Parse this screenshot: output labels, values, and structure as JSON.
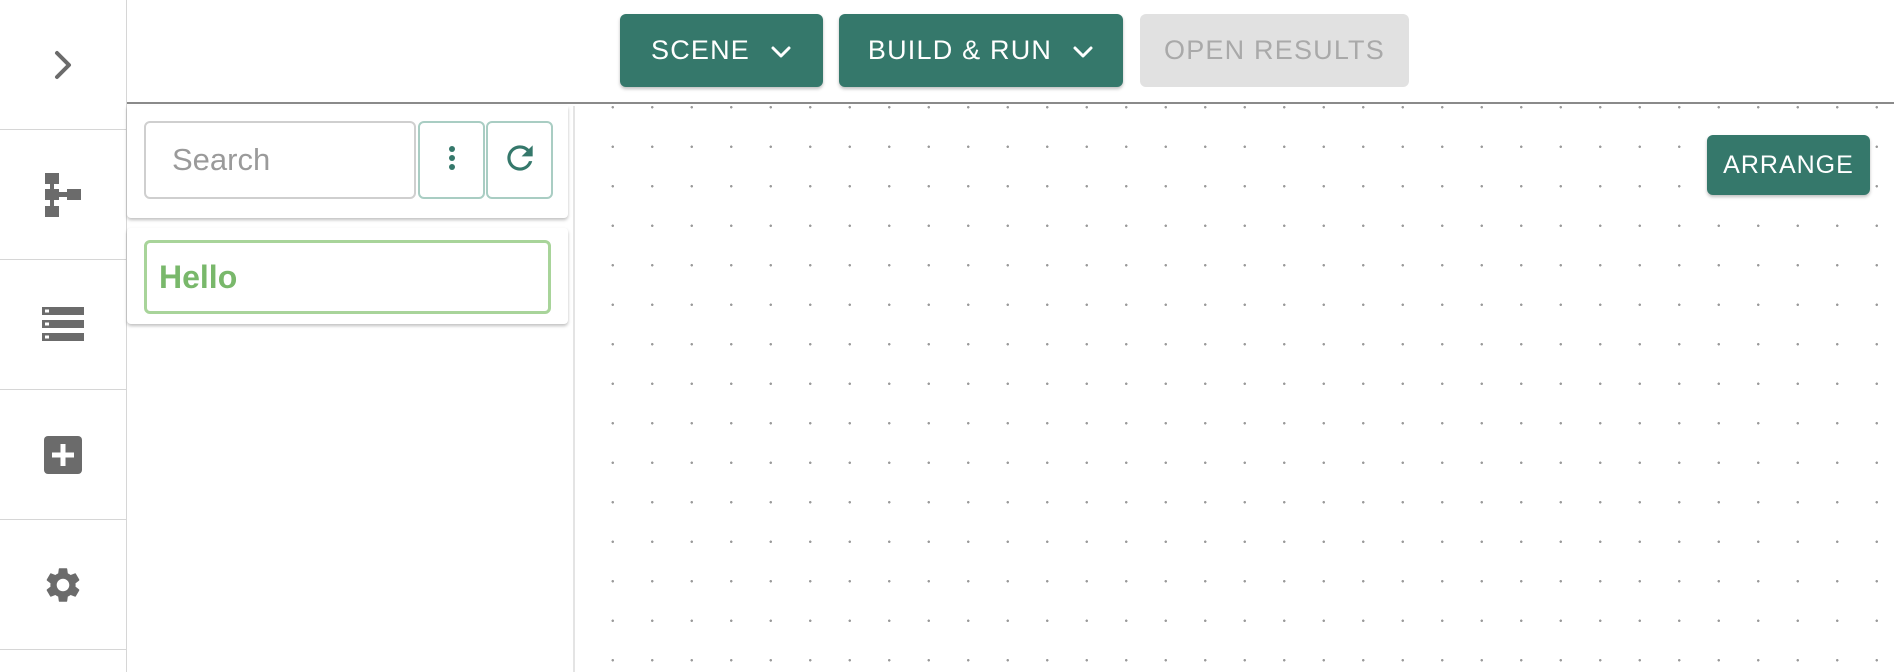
{
  "sidebar": {
    "items": [
      {
        "name": "expand",
        "icon": "chevron-right-icon"
      },
      {
        "name": "hierarchy",
        "icon": "hierarchy-icon"
      },
      {
        "name": "list",
        "icon": "list-icon"
      },
      {
        "name": "add",
        "icon": "add-box-icon"
      },
      {
        "name": "settings",
        "icon": "gear-icon"
      }
    ]
  },
  "toolbar": {
    "scene_label": "SCENE",
    "build_run_label": "BUILD & RUN",
    "open_results_label": "OPEN RESULTS"
  },
  "panel": {
    "search_placeholder": "Search",
    "search_value": "",
    "more_icon": "more-vertical-icon",
    "refresh_icon": "refresh-icon",
    "items": [
      {
        "label": "Hello"
      }
    ]
  },
  "canvas": {
    "arrange_label": "ARRANGE"
  },
  "colors": {
    "primary": "#35786b",
    "disabled_bg": "#e1e1e1",
    "disabled_text": "#a9a9a9",
    "item_green": "#79b86b",
    "item_border": "#a8d49a",
    "icon_gray": "#6b6b6b"
  }
}
